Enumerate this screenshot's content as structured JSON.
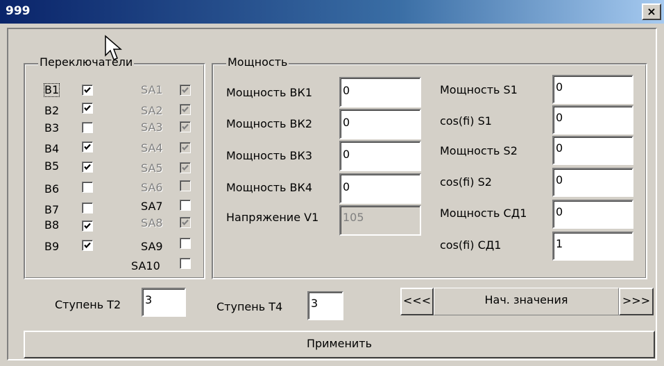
{
  "window": {
    "title": "999",
    "close_glyph": "×"
  },
  "switches": {
    "legend": "Переключатели",
    "b_items": [
      {
        "label": "B1",
        "checked": true
      },
      {
        "label": "B2",
        "checked": true
      },
      {
        "label": "B3",
        "checked": false
      },
      {
        "label": "B4",
        "checked": true
      },
      {
        "label": "B5",
        "checked": true
      },
      {
        "label": "B6",
        "checked": false
      },
      {
        "label": "B7",
        "checked": false
      },
      {
        "label": "B8",
        "checked": true
      },
      {
        "label": "B9",
        "checked": true
      }
    ],
    "sa_items": [
      {
        "label": "SA1",
        "checked": true,
        "enabled": false
      },
      {
        "label": "SA2",
        "checked": true,
        "enabled": false
      },
      {
        "label": "SA3",
        "checked": true,
        "enabled": false
      },
      {
        "label": "SA4",
        "checked": true,
        "enabled": false
      },
      {
        "label": "SA5",
        "checked": true,
        "enabled": false
      },
      {
        "label": "SA6",
        "checked": false,
        "enabled": false
      },
      {
        "label": "SA7",
        "checked": false,
        "enabled": true
      },
      {
        "label": "SA8",
        "checked": true,
        "enabled": false
      },
      {
        "label": "SA9",
        "checked": false,
        "enabled": true
      },
      {
        "label": "SA10",
        "checked": false,
        "enabled": true
      }
    ]
  },
  "power": {
    "legend": "Мощность",
    "left": [
      {
        "label": "Мощность ВК1",
        "value": "0"
      },
      {
        "label": "Мощность ВК2",
        "value": "0"
      },
      {
        "label": "Мощность ВК3",
        "value": "0"
      },
      {
        "label": "Мощность ВК4",
        "value": "0"
      },
      {
        "label": "Напряжение V1",
        "value": "105"
      }
    ],
    "right": [
      {
        "label": "Мощность S1",
        "value": "0"
      },
      {
        "label": "cos(fi) S1",
        "value": "0"
      },
      {
        "label": "Мощность S2",
        "value": "0"
      },
      {
        "label": "cos(fi) S2",
        "value": "0"
      },
      {
        "label": "Мощность СД1",
        "value": "0"
      },
      {
        "label": "cos(fi) СД1",
        "value": "1"
      }
    ]
  },
  "bottom": {
    "t2_label": "Ступень Т2",
    "t2_value": "3",
    "t4_label": "Ступень Т4",
    "t4_value": "3",
    "prev": "<<<",
    "preset": "Нач. значения",
    "next": ">>>",
    "apply": "Применить"
  }
}
